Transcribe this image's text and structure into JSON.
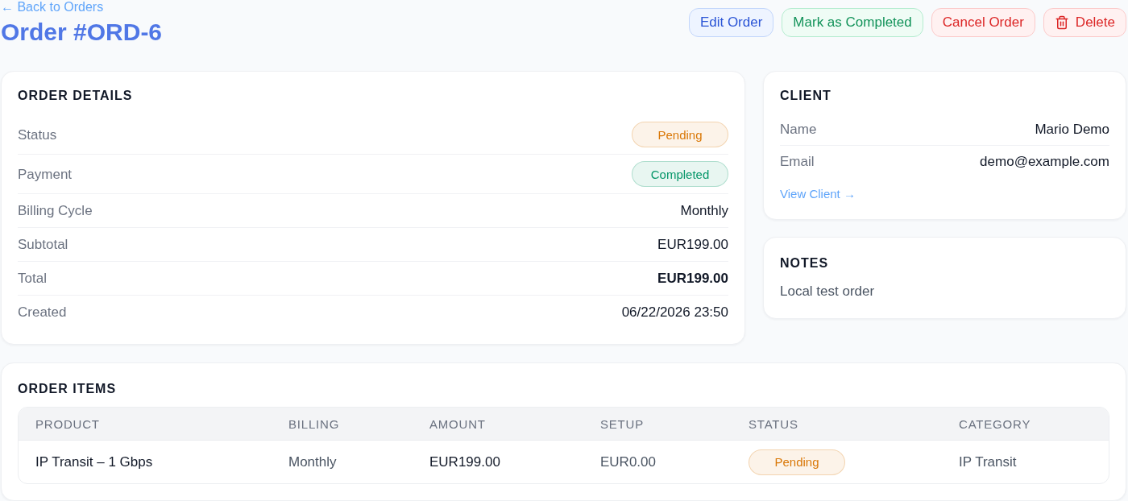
{
  "back_link": {
    "label": "← Back to Orders"
  },
  "title": "Order #ORD-6",
  "actions": [
    {
      "label": "Edit Order",
      "kind": "edit"
    },
    {
      "label": "Mark as Completed",
      "kind": "complete"
    },
    {
      "label": "Cancel Order",
      "kind": "cancel"
    },
    {
      "label": "Delete",
      "kind": "delete"
    }
  ],
  "order_details": {
    "title": "ORDER DETAILS",
    "rows": [
      {
        "label": "Status",
        "kind": "badge",
        "value": "Pending",
        "color": "#d97706"
      },
      {
        "label": "Payment",
        "kind": "badge",
        "value": "Completed",
        "color": "#059669"
      },
      {
        "label": "Billing Cycle",
        "kind": "text",
        "value": "Monthly"
      },
      {
        "label": "Subtotal",
        "kind": "text",
        "value": "EUR199.00"
      },
      {
        "label": "Total",
        "kind": "bold",
        "value": "EUR199.00"
      },
      {
        "label": "Created",
        "kind": "text",
        "value": "06/22/2026 23:50"
      }
    ]
  },
  "client": {
    "title": "CLIENT",
    "fields": [
      {
        "label": "Name",
        "value": "Mario Demo"
      },
      {
        "label": "Email",
        "value": "demo@example.com"
      }
    ],
    "link": "View Client →"
  },
  "notes": {
    "title": "NOTES",
    "text": "Local test order"
  },
  "order_items": {
    "title": "ORDER ITEMS",
    "columns": [
      "PRODUCT",
      "BILLING",
      "AMOUNT",
      "SETUP",
      "STATUS",
      "CATEGORY"
    ],
    "rows": [
      {
        "product": "IP Transit – 1 Gbps",
        "billing": "Monthly",
        "amount": "EUR199.00",
        "setup": "EUR0.00",
        "status": {
          "label": "Pending",
          "color": "#d97706"
        },
        "category": "IP Transit"
      }
    ]
  }
}
